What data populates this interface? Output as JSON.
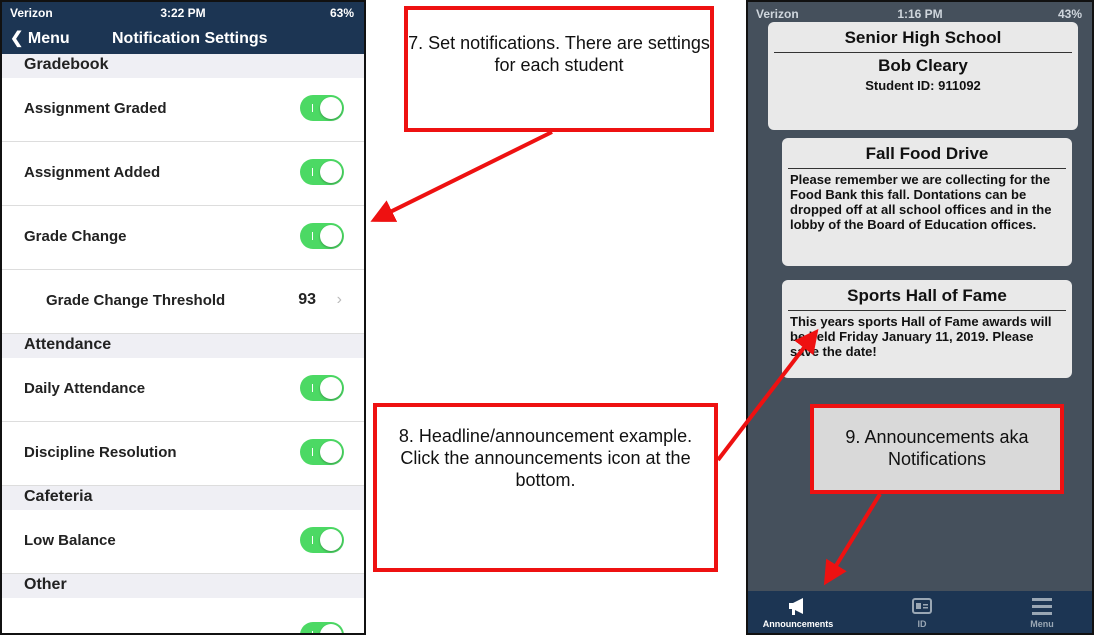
{
  "left_phone": {
    "status": {
      "carrier": "Verizon",
      "time": "3:22 PM",
      "battery": "63%"
    },
    "nav": {
      "back_label": "Menu",
      "title": "Notification Settings"
    },
    "sections": {
      "gradebook": "Gradebook",
      "attendance": "Attendance",
      "cafeteria": "Cafeteria",
      "other": "Other"
    },
    "rows": {
      "assignment_graded": "Assignment Graded",
      "assignment_added": "Assignment Added",
      "grade_change": "Grade Change",
      "threshold_label": "Grade Change Threshold",
      "threshold_value": "93",
      "daily_attendance": "Daily Attendance",
      "discipline_resolution": "Discipline Resolution",
      "low_balance": "Low Balance"
    },
    "toggle_color": "#4cd964"
  },
  "right_phone": {
    "status": {
      "carrier": "Verizon",
      "time": "1:16 PM",
      "battery": "43%"
    },
    "school": {
      "title": "Senior High School",
      "student_name": "Bob Cleary",
      "student_id": "Student ID: 911092"
    },
    "announcements": [
      {
        "title": "Fall Food Drive",
        "body": "Please remember we are collecting for the Food Bank this fall. Dontations can be dropped off at all school offices and in the lobby of the Board of Education offices."
      },
      {
        "title": "Sports Hall of Fame",
        "body": "This years sports Hall of Fame awards will be held Friday January 11, 2019. Please save the date!"
      }
    ],
    "tabs": {
      "announcements": "Announcements",
      "id": "ID",
      "menu": "Menu"
    },
    "colors": {
      "background": "#45505c",
      "tabbar": "#1c3553"
    }
  },
  "callouts": {
    "c7": "7. Set notifications. There are settings for each student",
    "c8": "8. Headline/announcement example. Click the announcements icon at the bottom.",
    "c9": "9. Announcements aka Notifications",
    "border_color": "#ee1111"
  }
}
